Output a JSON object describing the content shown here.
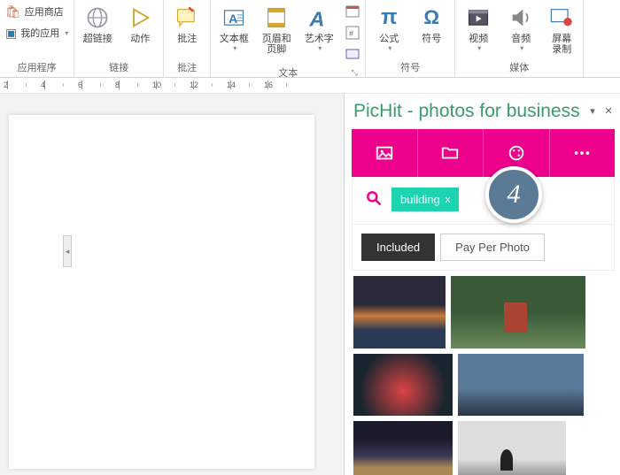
{
  "ribbon": {
    "groups": {
      "apps": {
        "label": "应用程序",
        "store": "应用商店",
        "myapps": "我的应用"
      },
      "links": {
        "label": "链接",
        "hyperlink": "超链接",
        "action": "动作"
      },
      "comments": {
        "label": "批注",
        "comment": "批注"
      },
      "text": {
        "label": "文本",
        "textbox": "文本框",
        "headerfooter": "页眉和页脚",
        "wordart": "艺术字"
      },
      "symbols": {
        "label": "符号",
        "equation": "公式",
        "symbol": "符号"
      },
      "media": {
        "label": "媒体",
        "video": "视频",
        "audio": "音频",
        "screenrec": "屏幕\n录制"
      }
    }
  },
  "ruler": {
    "marks": [
      "2",
      "4",
      "6",
      "8",
      "10",
      "12",
      "14",
      "16"
    ]
  },
  "pane": {
    "title": "PicHit - photos for business",
    "search": {
      "tag": "building",
      "tag_close": "x"
    },
    "tabs": {
      "included": "Included",
      "payper": "Pay Per Photo"
    }
  },
  "badge": "4"
}
